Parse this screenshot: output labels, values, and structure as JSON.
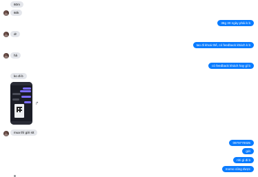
{
  "messages_in": [
    {
      "text": "60m"
    },
    {
      "text": "60k"
    },
    {
      "text": "dr"
    },
    {
      "text": "hả"
    },
    {
      "text": "ko đi b"
    },
    {
      "text": "mua thì gửi stt"
    }
  ],
  "messages_out": [
    {
      "text": "38g 30 ngày phải k b"
    },
    {
      "text": "tao đi khoá thế, có feedback khách k b"
    },
    {
      "text": "có feedback khách hay gì b"
    },
    {
      "text": "0979770025"
    },
    {
      "text": "gửi"
    },
    {
      "text": "nhi gì đi b"
    },
    {
      "text": "momo cũng được"
    }
  ],
  "icons": {
    "share": "share-icon",
    "avatar": "contact-avatar"
  },
  "colors": {
    "outgoing": "#0a7cff",
    "incoming": "#e4e6eb"
  }
}
